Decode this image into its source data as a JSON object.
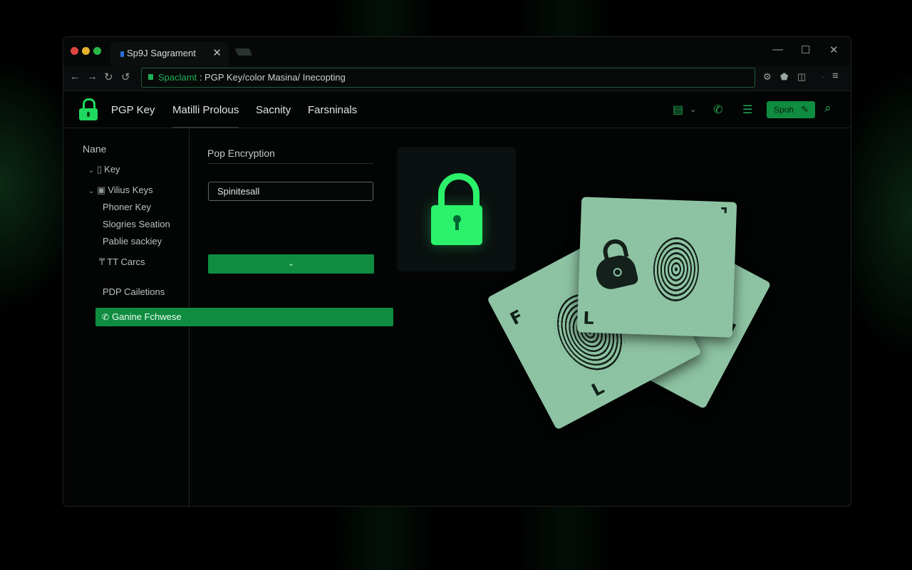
{
  "window": {
    "tab_title": "Sp9J Sagrament",
    "tab_close": "✕",
    "controls": {
      "minimize": "—",
      "maximize": "☐",
      "close": "✕"
    }
  },
  "address_bar": {
    "prefix": "Spaclamt",
    "url": " : PGP Key/​color Masina/ Inecopting"
  },
  "header": {
    "app_name": "PGP Key",
    "nav": [
      "Matilli Prolous",
      "Sacnity",
      "Farsninals"
    ],
    "search_label": "Spoh",
    "icon_chevron": "⌄"
  },
  "sidebar": {
    "heading": "Nane",
    "items": [
      {
        "label": "Key"
      },
      {
        "label": "Vilius Keys"
      },
      {
        "label": "Phoner Key"
      },
      {
        "label": "Slogries Seation"
      },
      {
        "label": "Pablie sackiey"
      },
      {
        "label": "TT Carcs"
      },
      {
        "label": "PDP Cailetions"
      },
      {
        "label": "Ganine Fchwese"
      }
    ]
  },
  "form": {
    "title": "Pop Encryption",
    "field_value": "Spinitesall",
    "button_icon": "⌄"
  },
  "colors": {
    "accent": "#0f8c40",
    "bright_green": "#2bf26a",
    "card": "#8dc3a2"
  },
  "icons": [
    "lock-icon",
    "search-icon",
    "phone-icon",
    "clipboard-icon",
    "list-icon",
    "pencil-icon",
    "fingerprint-icon",
    "padlock-icon"
  ]
}
